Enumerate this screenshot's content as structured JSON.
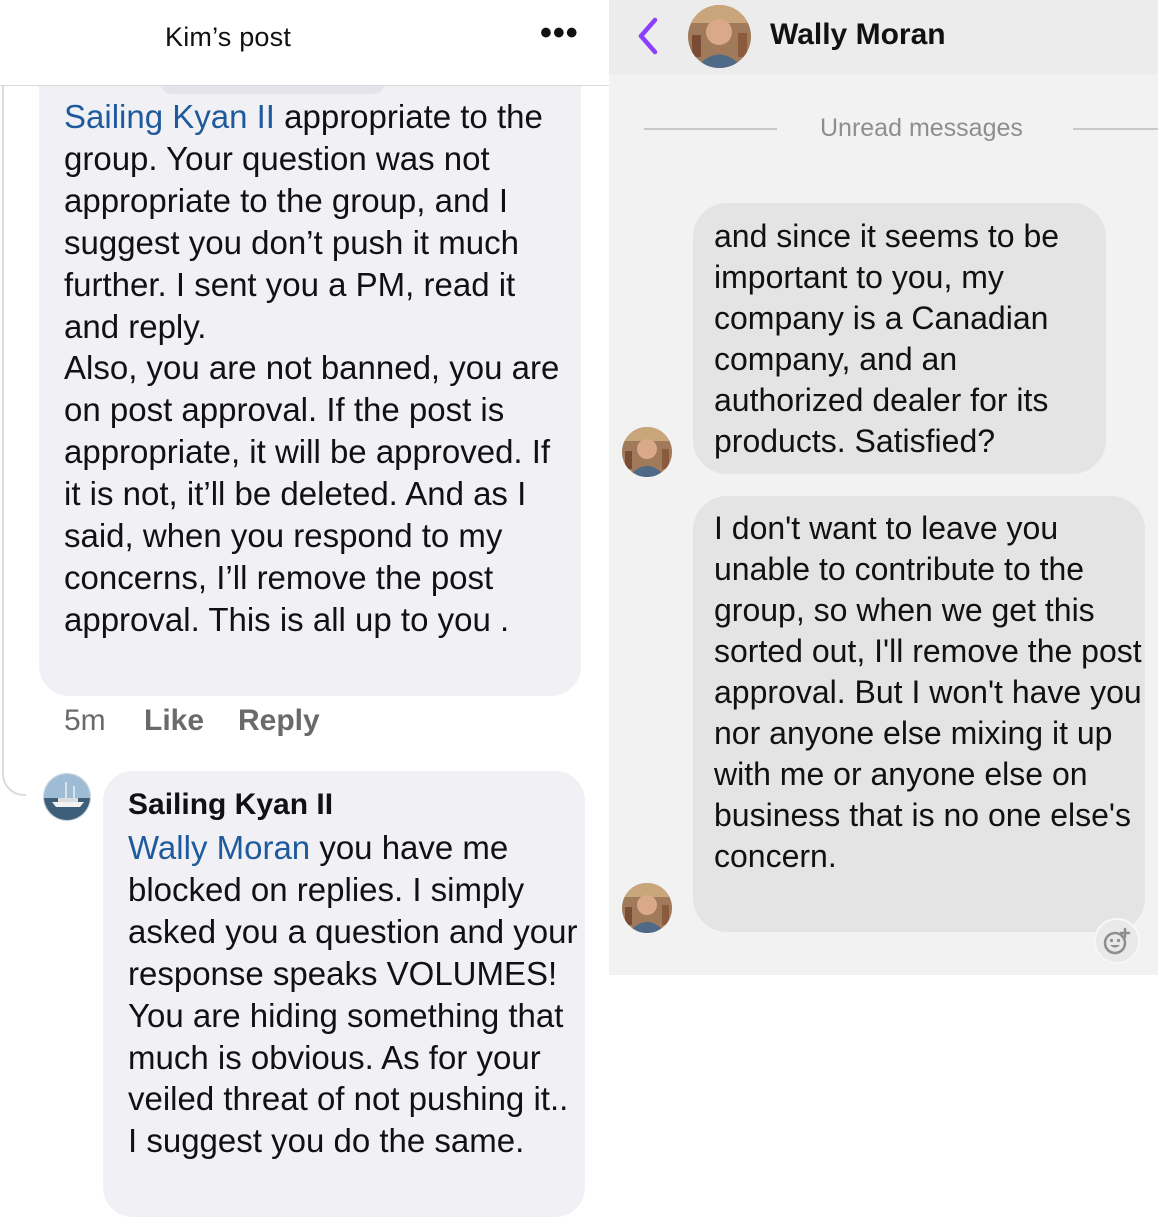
{
  "left_panel": {
    "header": {
      "title": "Kim’s post",
      "more_icon": "more-horizontal-icon"
    },
    "comment1": {
      "mention": "Sailing Kyan II",
      "text_after_mention": " appropriate to the group. Your question was not appropriate to the group, and I suggest you don’t push it much further. I sent you a PM, read it and reply.",
      "text_second_paragraph": "Also, you are not banned, you are on post approval. If the post is appropriate, it will be approved. If it is not, it’ll be deleted. And as I said, when you respond to my concerns, I’ll remove the post approval. This is all up to you .",
      "time": "5m",
      "like_label": "Like",
      "reply_label": "Reply"
    },
    "comment2": {
      "author": "Sailing Kyan II",
      "avatar_icon": "sailboat-avatar",
      "mention": "Wally Moran",
      "text_after_mention": " you have me blocked on replies. I simply asked you a question and your response speaks VOLUMES! You are hiding something that much is obvious. As for your veiled threat of not pushing it.. I suggest you do the same."
    }
  },
  "right_panel": {
    "header": {
      "back_icon": "chevron-left-icon",
      "name": "Wally Moran",
      "accent_color": "#8a3ffc"
    },
    "divider_label": "Unread messages",
    "messages": [
      {
        "text": "and since it seems to be important to you, my company is a Canadian company, and an authorized dealer for its products. Satisfied?"
      },
      {
        "text": "I don't want to leave you unable to contribute to the group, so when we get this sorted out, I'll remove the post approval. But I won't have you nor anyone else mixing it up with me or anyone else on business that is no one else's concern."
      }
    ],
    "reaction_icon": "add-reaction-icon"
  }
}
